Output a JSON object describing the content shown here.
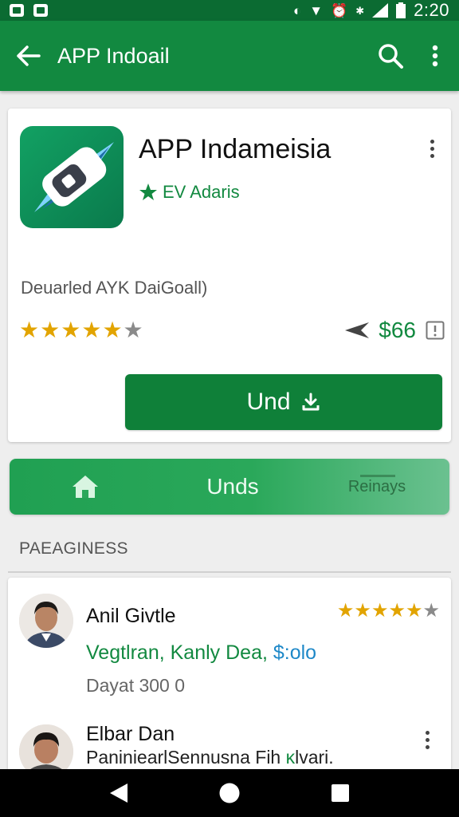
{
  "status_bar": {
    "time": "2:20",
    "icons": [
      "notification-icon",
      "image-icon",
      "sync-icon",
      "wifi-icon",
      "alarm-icon",
      "bluetooth-icon",
      "signal-icon",
      "battery-icon"
    ]
  },
  "app_bar": {
    "title": "APP Indoail",
    "back_icon": "arrow-left-icon",
    "search_icon": "search-icon",
    "menu_icon": "more-vert-icon"
  },
  "app": {
    "name": "APP Indameisia",
    "developer": "EV Adaris",
    "subtitle": "Deuarled AYK DaiGoall)",
    "rating": 5,
    "rating_max": 6,
    "price": "$66",
    "install_label": "Und"
  },
  "tabs": {
    "home_icon": "home-icon",
    "main": "Unds",
    "reviews": "Reinays"
  },
  "section_header": "PAEAGINESS",
  "reviews": [
    {
      "name": "Anil Givtle",
      "rating": 5,
      "rating_max": 6,
      "tags_main": "Vegtlran, Kanly Dea, ",
      "tags_accent": "$:olo",
      "date": "Dayat 300 0"
    },
    {
      "name": "Elbar Dan",
      "text": "PaniniearlSennusna Fih",
      "text_mark": "ĸ",
      "text_tail": "lvari."
    }
  ],
  "colors": {
    "primary": "#128940",
    "status_bar": "#0b6b32",
    "install": "#0f8039",
    "star": "#e2a400",
    "accent_link": "#1e88c8"
  }
}
